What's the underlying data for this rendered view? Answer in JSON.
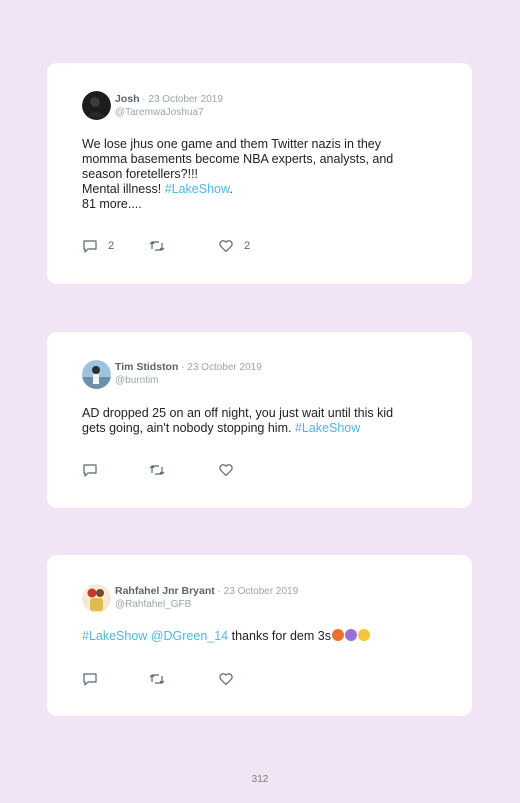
{
  "tweets": [
    {
      "name": "Josh",
      "date": "23 October 2019",
      "handle": "@TaremwaJoshua7",
      "lines": [
        "We lose jhus one game and them Twitter nazis in they",
        "momma basements become NBA experts, analysts, and",
        "season foretellers?!!!"
      ],
      "line4_text": "Mental illness! ",
      "line4_tag": "#LakeShow",
      "line4_end": ".",
      "line5": "81 more....",
      "reply_count": "2",
      "like_count": "2"
    },
    {
      "name": "Tim Stidston",
      "date": "23 October 2019",
      "handle": "@burntim",
      "line1": "AD dropped 25 on an off night, you just wait until this kid",
      "line2_text": "gets going, ain't nobody stopping him. ",
      "line2_tag": "#LakeShow"
    },
    {
      "name": "Rahfahel Jnr Bryant",
      "date": "23 October 2019",
      "handle": "@Rahfahel_GFB",
      "tag1": "#LakeShow",
      "tag2": "@DGreen_14",
      "text": " thanks for dem 3s"
    }
  ],
  "separator": " · ",
  "page_number": "312",
  "colors": {
    "background": "#f1e4f4",
    "link": "#4fb7e0",
    "icon": "#5a6470"
  }
}
